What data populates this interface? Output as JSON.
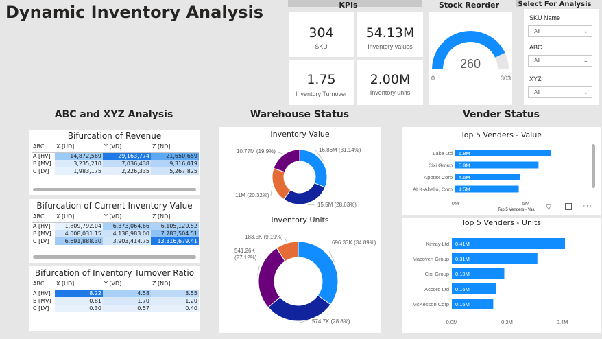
{
  "title": "Dynamic Inventory Analysis",
  "kpis": {
    "header": "KPIs",
    "cards": [
      {
        "value": "304",
        "label": "SKU"
      },
      {
        "value": "54.13M",
        "label": "Inventory values"
      },
      {
        "value": "1.75",
        "label": "Inventory Turnover"
      },
      {
        "value": "2.00M",
        "label": "Inventory units"
      }
    ]
  },
  "stock_reorder": {
    "header": "Stock Reorder",
    "value": "260",
    "min": "0",
    "max": "303",
    "fraction": 0.858,
    "color": "#118dff"
  },
  "slicers": {
    "header": "Select For Analysis",
    "items": [
      {
        "label": "SKU Name",
        "value": "All"
      },
      {
        "label": "ABC",
        "value": "All"
      },
      {
        "label": "XYZ",
        "value": "All"
      }
    ]
  },
  "sections": {
    "abc_xyz": "ABC  and XYZ Analysis",
    "warehouse": "Warehouse Status",
    "vender": "Vender Status"
  },
  "matrices": [
    {
      "title": "Bifurcation of Revenue",
      "headers": [
        "ABC",
        "X [UD]",
        "Y [VD]",
        "Z [ND]"
      ],
      "rows": [
        {
          "label": "A [HV]",
          "cells": [
            "14,872,569",
            "29,163,774",
            "21,650,659"
          ]
        },
        {
          "label": "B [MV]",
          "cells": [
            "3,235,210",
            "7,036,438",
            "9,316,019"
          ]
        },
        {
          "label": "C [LV]",
          "cells": [
            "1,983,175",
            "2,226,335",
            "5,267,825"
          ]
        }
      ],
      "shades": [
        [
          "#9ccbf7",
          "#1f7ae8",
          "#5ea9f2"
        ],
        [
          "#dcebfb",
          "#c2dcf8",
          "#b2d3f8"
        ],
        [
          "#e5f1fc",
          "#e4effb",
          "#cfe4f9"
        ]
      ]
    },
    {
      "title": "Bifurcation of Current Inventory Value",
      "headers": [
        "ABC",
        "X [UD]",
        "Y [VD]",
        "Z [ND]"
      ],
      "rows": [
        {
          "label": "A [HV]",
          "cells": [
            "1,809,792.04",
            "6,373,064.66",
            "6,105,120.52"
          ]
        },
        {
          "label": "B [MV]",
          "cells": [
            "4,008,031.15",
            "4,138,983.00",
            "7,783,504.51"
          ]
        },
        {
          "label": "C [LV]",
          "cells": [
            "6,691,888.30",
            "3,903,414.75",
            "13,316,679.41"
          ]
        }
      ],
      "shades": [
        [
          "#e5f1fc",
          "#a9d0f7",
          "#acd2f7"
        ],
        [
          "#cfe4f9",
          "#cce2f9",
          "#8ec2f5"
        ],
        [
          "#9fcbf6",
          "#d2e6fa",
          "#1f7ae8"
        ]
      ]
    },
    {
      "title": "Bifurcation of Inventory Turnover Ratio",
      "headers": [
        "ABC",
        "X [UD]",
        "Y [VD]",
        "Z [ND]"
      ],
      "rows": [
        {
          "label": "A [HV]",
          "cells": [
            "8.22",
            "4.58",
            "3.55"
          ]
        },
        {
          "label": "B [MV]",
          "cells": [
            "0.81",
            "1.70",
            "1.20"
          ]
        },
        {
          "label": "C [LV]",
          "cells": [
            "0.30",
            "0.57",
            "0.40"
          ]
        }
      ],
      "shades": [
        [
          "#1f7ae8",
          "#a9d0f7",
          "#bcd9f8"
        ],
        [
          "#e2effb",
          "#d7e8fa",
          "#dfedfb"
        ],
        [
          "#e8f2fc",
          "#e4effb",
          "#e6f1fc"
        ]
      ]
    }
  ],
  "chart_data": [
    {
      "type": "pie",
      "title": "Inventory Value",
      "slices": [
        {
          "value": 16.86,
          "label": "16.86M (31.14%)",
          "color": "#118dff"
        },
        {
          "value": 15.5,
          "label": "15.5M (28.63%)",
          "color": "#12239e"
        },
        {
          "value": 11,
          "label": "11M (20.32%)",
          "color": "#e66c37"
        },
        {
          "value": 10.77,
          "label": "10.77M (19.9%)",
          "color": "#6b007b"
        }
      ]
    },
    {
      "type": "pie",
      "title": "Inventory Units",
      "slices": [
        {
          "value": 696.33,
          "label": "696.33K (34.89%)",
          "color": "#118dff"
        },
        {
          "value": 574.7,
          "label": "574.7K (28.8%)",
          "color": "#12239e"
        },
        {
          "value": 541.26,
          "label": "541.26K (27.12%)",
          "color": "#6b007b"
        },
        {
          "value": 183.5,
          "label": "183.5K (9.19%)",
          "color": "#e66c37"
        }
      ]
    },
    {
      "type": "bar",
      "title": "Top 5 Venders - Value",
      "categories": [
        "Lake Ltd",
        "Cixi Group",
        "Apotex Corp",
        "ALK-Abello, Corp"
      ],
      "values": [
        6.8,
        5.9,
        4.6,
        4.5
      ],
      "value_labels": [
        "6.8M",
        "5.9M",
        "4.6M",
        "4.5M"
      ],
      "ticks": [
        "0M",
        "5M"
      ],
      "xlim": [
        0,
        8.7
      ],
      "color": "#118dff",
      "tooltip": "Top 5 Venders - Valu"
    },
    {
      "type": "bar",
      "title": "Top 5 Venders - Units",
      "categories": [
        "Kinray Ltd",
        "Macoven Group",
        "Cixi Group",
        "Accord Ltd",
        "McKesson Corp"
      ],
      "values": [
        0.41,
        0.31,
        0.19,
        0.16,
        0.15
      ],
      "value_labels": [
        "0.41M",
        "0.31M",
        "0.19M",
        "0.16M",
        "0.15M"
      ],
      "ticks": [
        "0.0M",
        "0.2M",
        "0.4M"
      ],
      "xlim": [
        0,
        0.4
      ],
      "color": "#118dff"
    }
  ]
}
